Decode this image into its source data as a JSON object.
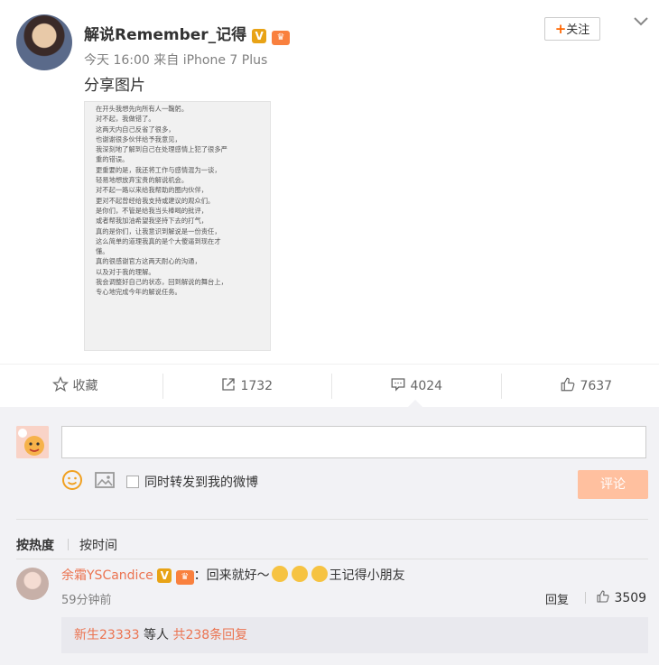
{
  "post": {
    "username": "解说Remember_记得",
    "verified_badge": "V",
    "follow_plus": "+",
    "follow_label": "关注",
    "time": "今天 16:00",
    "source": "来自 iPhone 7 Plus",
    "text": "分享图片",
    "image_lines": [
      "在开头我想先向所有人一鞠躬。",
      "对不起，我做错了。",
      "这两天内自己反省了很多，",
      "也谢谢很多伙伴给予我意见，",
      "我深刻地了解到自己在处理感情上犯了很多严",
      "重的错误。",
      "更重要的是，我还将工作与感情混为一谈，",
      "轻易地想放弃宝贵的解说机会。",
      "对不起一路以来给我帮助的圈内伙伴，",
      "更对不起曾经给我支持或建议的观众们。",
      "是你们，不管是给我当头棒喝的批评，",
      "或者帮我加油希望我坚持下去的打气，",
      "真的是你们，让我意识到解说是一份责任，",
      "这么简单的道理我真的是个大傻逼到现在才",
      "懂。",
      "真的很感谢官方这两天耐心的沟通，",
      "以及对于我的理解。",
      "我会调整好自己的状态，回到解说的舞台上，",
      "专心地完成今年的解说任务。"
    ]
  },
  "actions": {
    "favorite": "收藏",
    "repost_count": "1732",
    "comment_count": "4024",
    "like_count": "7637"
  },
  "composer": {
    "input_value": "",
    "repost_label": "同时转发到我的微博",
    "submit_label": "评论"
  },
  "sort": {
    "hot": "按热度",
    "time": "按时间"
  },
  "comment": {
    "user": "余霜YSCandice",
    "verified_badge": "V",
    "colon": "：",
    "text_prefix": "回来就好～",
    "text_suffix": "王记得小朋友",
    "time": "59分钟前",
    "reply_label": "回复",
    "like_count": "3509",
    "replies_user": "新生23333",
    "replies_middle": "等人",
    "replies_total": "共238条回复"
  },
  "colors": {
    "accent": "#eb7350",
    "follow_plus": "#ff6600",
    "submit_bg": "#ffc09f",
    "verified": "#e8a316"
  }
}
